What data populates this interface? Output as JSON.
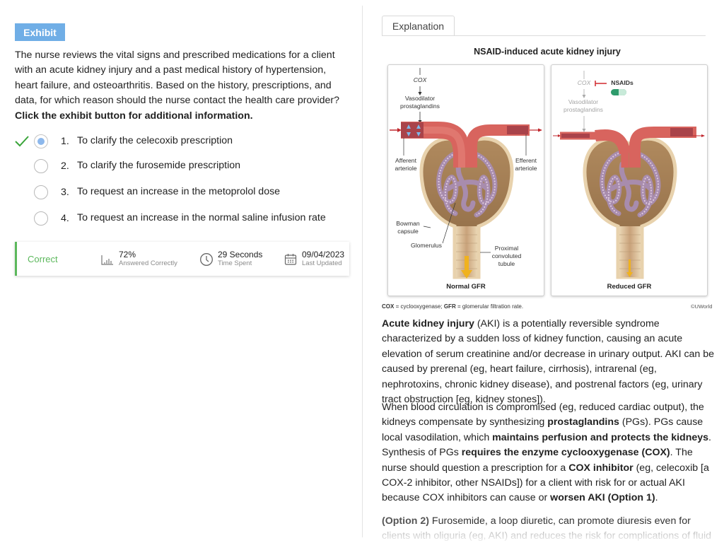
{
  "question": {
    "exhibit_label": "Exhibit",
    "stem": "The nurse reviews the vital signs and prescribed medications for a client with an acute kidney injury and a past medical history of hypertension, heart failure, and osteoarthritis.  Based on the history, prescriptions, and data, for which reason should the nurse contact the health care provider?",
    "stem_bold": "Click the exhibit button for additional information.",
    "options": [
      {
        "number": "1.",
        "text": "To clarify the celecoxib prescription",
        "selected": true,
        "correct": true
      },
      {
        "number": "2.",
        "text": "To clarify the furosemide prescription",
        "selected": false,
        "correct": false
      },
      {
        "number": "3.",
        "text": "To request an increase in the metoprolol dose",
        "selected": false,
        "correct": false
      },
      {
        "number": "4.",
        "text": "To request an increase in the normal saline infusion rate",
        "selected": false,
        "correct": false
      }
    ]
  },
  "result": {
    "status": "Correct",
    "status_color": "#5cb85c",
    "percent": "72%",
    "percent_label": "Answered Correctly",
    "percent_icon": "bar-chart-icon",
    "time": "29 Seconds",
    "time_label": "Time Spent",
    "time_icon": "clock-icon",
    "date": "09/04/2023",
    "date_label": "Last Updated",
    "date_icon": "calendar-icon"
  },
  "explanation": {
    "tab_label": "Explanation",
    "figure": {
      "title": "NSAID-induced acute kidney injury",
      "left_panel": {
        "cox": "COX",
        "vasodilator": "Vasodilator",
        "prostaglandins": "prostaglandins",
        "afferent1": "Afferent",
        "afferent2": "arteriole",
        "efferent1": "Efferent",
        "efferent2": "arteriole",
        "bowman1": "Bowman",
        "bowman2": "capsule",
        "glomerulus": "Glomerulus",
        "pct1": "Proximal",
        "pct2": "convoluted",
        "pct3": "tubule",
        "caption": "Normal GFR"
      },
      "right_panel": {
        "cox": "COX",
        "nsaids": "NSAIDs",
        "vasodilator": "Vasodilator",
        "prostaglandins": "prostaglandins",
        "caption": "Reduced GFR"
      },
      "footnote_cox_abbr": "COX",
      "footnote_cox_def": " = cyclooxygenase; ",
      "footnote_gfr_abbr": "GFR",
      "footnote_gfr_def": " = glomerular filtration rate.",
      "copyright": "©UWorld"
    },
    "p1": {
      "b1": "Acute kidney injury",
      "t1": " (AKI) is a potentially reversible syndrome characterized by a sudden loss of kidney function, causing an acute elevation of serum creatinine and/or decrease in urinary output.  AKI can be caused by prerenal (eg, heart failure, cirrhosis), intrarenal (eg, nephrotoxins, chronic kidney disease), and postrenal factors (eg, urinary tract obstruction [eg, kidney stones])."
    },
    "p2": {
      "t1": "When blood circulation is compromised (eg, reduced cardiac output), the kidneys compensate by synthesizing ",
      "b1": "prostaglandins",
      "t2": " (PGs).  PGs cause local vasodilation, which ",
      "b2": "maintains perfusion and protects the kidneys",
      "t3": ".  Synthesis of PGs ",
      "b3": "requires the enzyme cyclooxygenase (COX)",
      "t4": ".  The nurse should question a prescription for a ",
      "b4": "COX inhibitor",
      "t5": " (eg, celecoxib [a COX-2 inhibitor, other NSAIDs]) for a client with risk for or actual AKI because COX inhibitors can cause or ",
      "b5": "worsen AKI (Option 1)",
      "t6": "."
    },
    "p3": {
      "b1": "(Option 2)",
      "t1": "  Furosemide, a loop diuretic, can promote diuresis even for clients with oliguria (eg, AKI) and reduces the risk for complications of fluid"
    }
  }
}
